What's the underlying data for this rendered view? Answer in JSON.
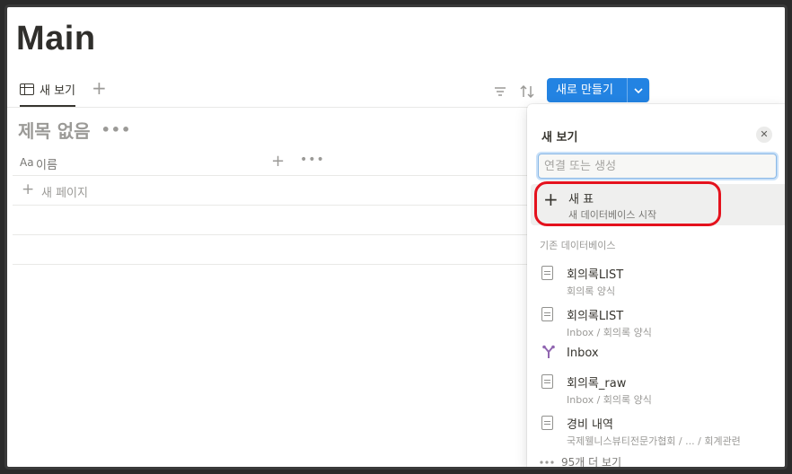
{
  "page": {
    "title": "Main"
  },
  "viewbar": {
    "tab_label": "새 보기",
    "add_view": "+",
    "icons": [
      "filter-icon",
      "sort-icon",
      "automation-icon",
      "search-icon",
      "expand-icon",
      "more-icon"
    ],
    "new_button_label": "새로 만들기",
    "new_button_chevron": "⌄",
    "accent": "#2383e2"
  },
  "database": {
    "title": "제목 없음",
    "more": "•••",
    "header": {
      "aa": "Aa",
      "name_column": "이름",
      "add": "+",
      "more": "•••"
    },
    "new_page": "새 페이지"
  },
  "popup": {
    "title": "새 보기",
    "close": "✕",
    "search_placeholder": "연결 또는 생성",
    "new_table": {
      "label": "새 표",
      "sub": "새 데이터베이스 시작"
    },
    "section_label": "기존 데이터베이스",
    "items": [
      {
        "name": "회의록LIST",
        "sub": "회의록 양식"
      },
      {
        "name": "회의록LIST",
        "sub": "Inbox / 회의록 양식"
      },
      {
        "name": "Inbox",
        "sub": ""
      },
      {
        "name": "회의록_raw",
        "sub": "Inbox / 회의록 양식"
      },
      {
        "name": "경비 내역",
        "sub": "국제웰니스뷰티전문가협회 / ... / 회계관련"
      }
    ],
    "more_label": "95개 더 보기",
    "highlight_color": "#e4121d"
  }
}
